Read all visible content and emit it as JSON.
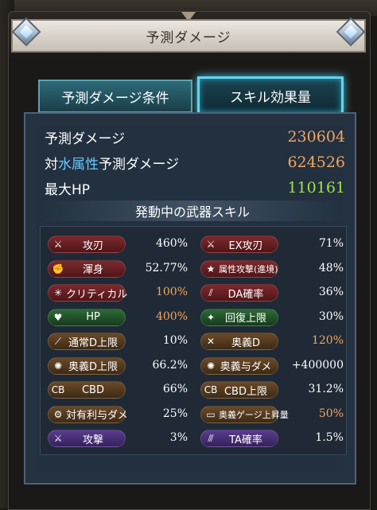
{
  "title": "予測ダメージ",
  "tabs": {
    "conditions": "予測ダメージ条件",
    "effects": "スキル効果量"
  },
  "stats": {
    "predicted_label": "予測ダメージ",
    "predicted_value": "230604",
    "vs_prefix": "対",
    "vs_attr": "水属性",
    "vs_suffix": "予測ダメージ",
    "vs_value": "624526",
    "maxhp_label": "最大HP",
    "maxhp_value": "110161"
  },
  "section_title": "発動中の武器スキル",
  "colors": {
    "orange": "#f3a561",
    "green": "#9fe24a",
    "water_attr": "#6cc6ff",
    "active_tab_glow": "#62d5f0"
  },
  "skills_left": [
    {
      "label": "攻刃",
      "value": "460%",
      "icon": "sword-icon",
      "highlight": false
    },
    {
      "label": "渾身",
      "value": "52.77%",
      "icon": "arm-icon",
      "highlight": false
    },
    {
      "label": "クリティカル",
      "value": "100%",
      "icon": "critical-icon",
      "highlight": true
    },
    {
      "label": "HP",
      "value": "400%",
      "icon": "heart-icon",
      "highlight": true
    },
    {
      "label": "通常D上限",
      "value": "10%",
      "icon": "slash-icon",
      "highlight": false
    },
    {
      "label": "奥義D上限",
      "value": "66.2%",
      "icon": "burst-icon",
      "highlight": false
    },
    {
      "label": "CBD",
      "value": "66%",
      "icon": "cb-icon",
      "highlight": false
    },
    {
      "label": "対有利与ダメ",
      "value": "25%",
      "icon": "gear-icon",
      "highlight": false
    },
    {
      "label": "攻撃",
      "value": "3%",
      "icon": "sword-icon",
      "highlight": false
    }
  ],
  "skills_right": [
    {
      "label": "EX攻刃",
      "value": "71%",
      "icon": "sword-icon",
      "highlight": false
    },
    {
      "label": "属性攻撃(進境)",
      "value": "48%",
      "icon": "star-icon",
      "highlight": false
    },
    {
      "label": "DA確率",
      "value": "36%",
      "icon": "double-slash-icon",
      "highlight": false
    },
    {
      "label": "回復上限",
      "value": "30%",
      "icon": "sparkle-icon",
      "highlight": false
    },
    {
      "label": "奥義D",
      "value": "120%",
      "icon": "cross-swords-icon",
      "highlight": true
    },
    {
      "label": "奥義与ダメ",
      "value": "+400000",
      "icon": "burst-icon",
      "highlight": false
    },
    {
      "label": "CBD上限",
      "value": "31.2%",
      "icon": "cb-icon",
      "highlight": false
    },
    {
      "label": "奥義ゲージ上昇量",
      "value": "50%",
      "icon": "gauge-icon",
      "highlight": true
    },
    {
      "label": "TA確率",
      "value": "1.5%",
      "icon": "triple-slash-icon",
      "highlight": false
    }
  ]
}
